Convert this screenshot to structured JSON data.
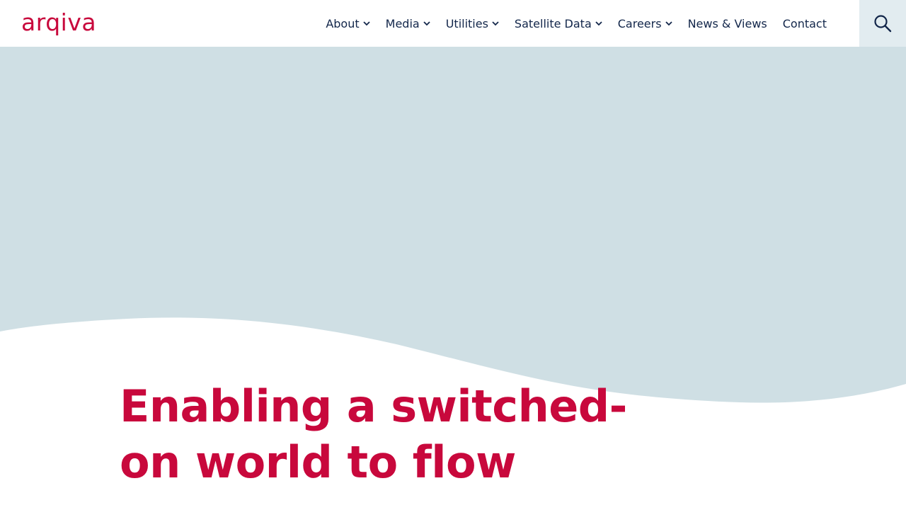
{
  "brand": {
    "logo_text": "arqiva",
    "accent_color": "#c8083c",
    "nav_text_color": "#12264a",
    "hero_bg_color": "#cfdfe4"
  },
  "nav": {
    "items": [
      {
        "label": "About",
        "has_dropdown": true
      },
      {
        "label": "Media",
        "has_dropdown": true
      },
      {
        "label": "Utilities",
        "has_dropdown": true
      },
      {
        "label": "Satellite Data",
        "has_dropdown": true
      },
      {
        "label": "Careers",
        "has_dropdown": true
      },
      {
        "label": "News & Views",
        "has_dropdown": false
      },
      {
        "label": "Contact",
        "has_dropdown": false
      }
    ],
    "search_icon": "search-icon"
  },
  "hero": {
    "headline": "Enabling a switched-on world to flow"
  }
}
